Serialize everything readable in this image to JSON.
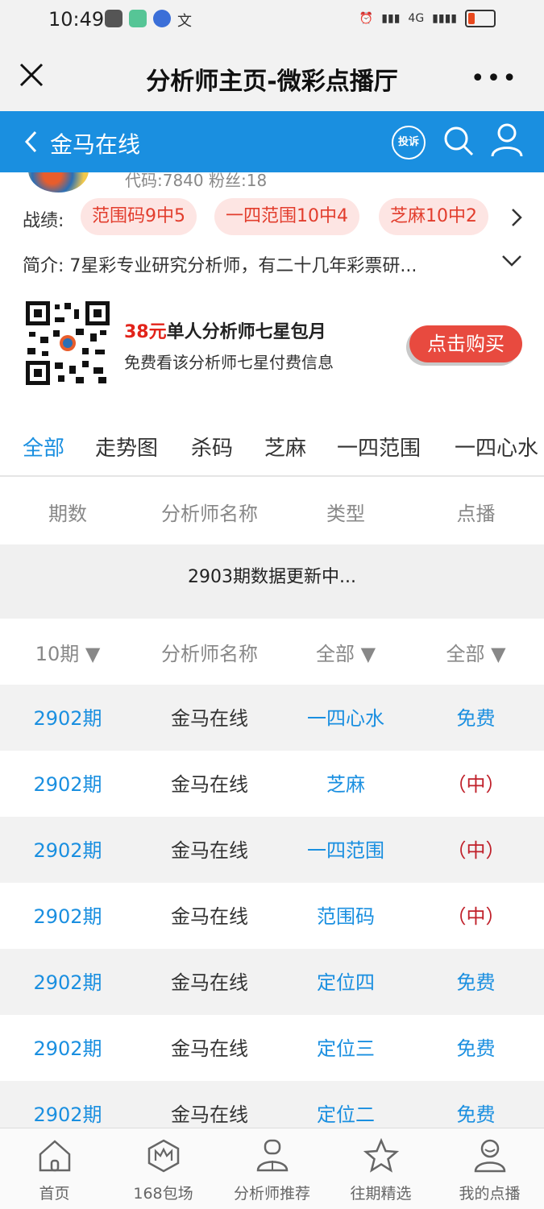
{
  "status": {
    "time": "10:49",
    "network": "4G"
  },
  "title_bar": {
    "title": "分析师主页-微彩点播厅",
    "more": "•••"
  },
  "nav": {
    "name": "金马在线",
    "complain_label": "投诉"
  },
  "profile": {
    "code_line": "代码:7840  粉丝:18"
  },
  "record": {
    "label": "战绩:",
    "pills": [
      "范围码9中5",
      "一四范围10中4",
      "芝麻10中2"
    ]
  },
  "intro": "简介: 7星彩专业研究分析师，有二十几年彩票研...",
  "promo": {
    "price": "38元",
    "title_rest": "单人分析师七星包月",
    "subtitle": "免费看该分析师七星付费信息",
    "buy_label": "点击购买"
  },
  "tabs": [
    "全部",
    "走势图",
    "杀码",
    "芝麻",
    "一四范围",
    "一四心水"
  ],
  "active_tab": "全部",
  "table_header": [
    "期数",
    "分析师名称",
    "类型",
    "点播"
  ],
  "notice": "2903期数据更新中...",
  "filters": [
    "10期 ▼",
    "分析师名称",
    "全部 ▼",
    "全部 ▼"
  ],
  "rows": [
    {
      "issue": "2902期",
      "analyst": "金马在线",
      "type": "一四心水",
      "play": "免费"
    },
    {
      "issue": "2902期",
      "analyst": "金马在线",
      "type": "芝麻",
      "play": "（中）"
    },
    {
      "issue": "2902期",
      "analyst": "金马在线",
      "type": "一四范围",
      "play": "（中）"
    },
    {
      "issue": "2902期",
      "analyst": "金马在线",
      "type": "范围码",
      "play": "（中）"
    },
    {
      "issue": "2902期",
      "analyst": "金马在线",
      "type": "定位四",
      "play": "免费"
    },
    {
      "issue": "2902期",
      "analyst": "金马在线",
      "type": "定位三",
      "play": "免费"
    },
    {
      "issue": "2902期",
      "analyst": "金马在线",
      "type": "定位二",
      "play": "免费"
    }
  ],
  "bottom_nav": [
    "首页",
    "168包场",
    "分析师推荐",
    "往期精选",
    "我的点播"
  ],
  "colors": {
    "primary": "#1a8fe0",
    "hit_red": "#c0202a",
    "buy_button": "#e84a3f"
  }
}
